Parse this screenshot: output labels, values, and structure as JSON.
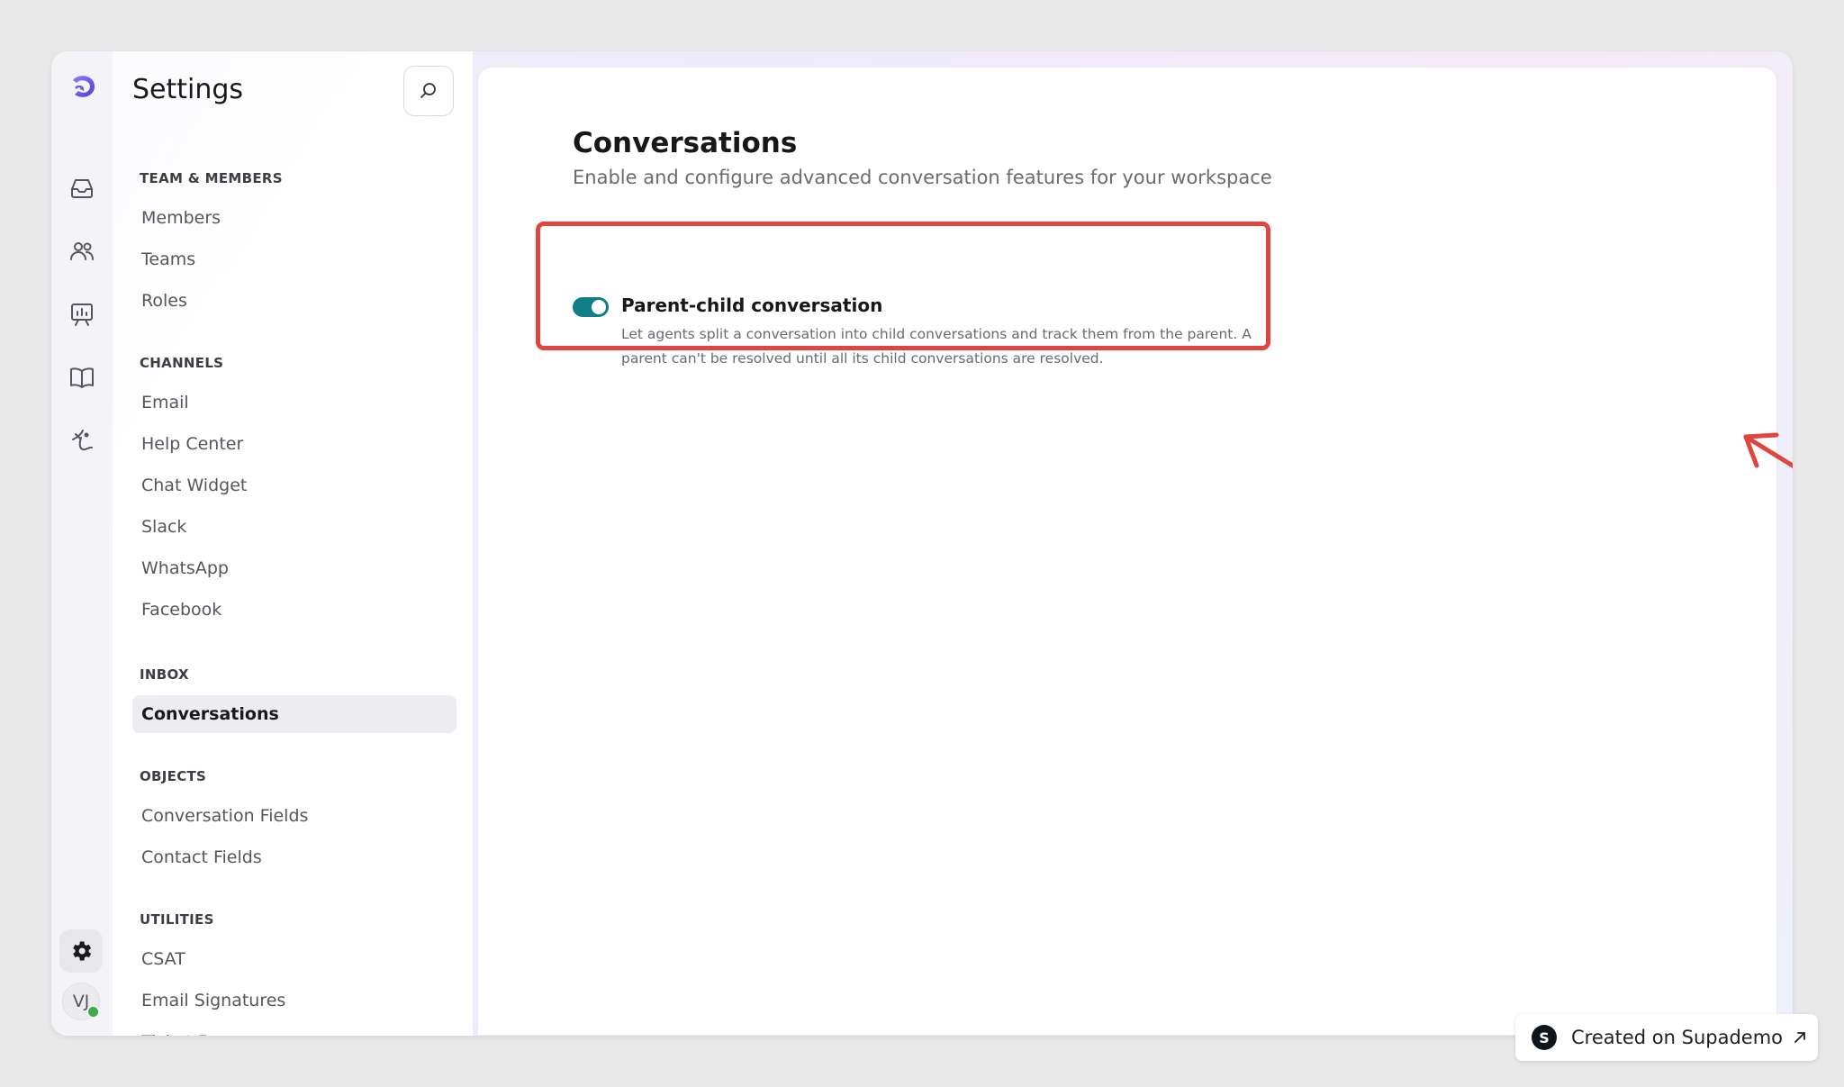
{
  "sidebar": {
    "title": "Settings",
    "groups": [
      {
        "title": "TEAM & MEMBERS",
        "items": [
          {
            "label": "Members"
          },
          {
            "label": "Teams"
          },
          {
            "label": "Roles"
          }
        ]
      },
      {
        "title": "CHANNELS",
        "items": [
          {
            "label": "Email"
          },
          {
            "label": "Help Center"
          },
          {
            "label": "Chat Widget"
          },
          {
            "label": "Slack"
          },
          {
            "label": "WhatsApp"
          },
          {
            "label": "Facebook"
          }
        ]
      },
      {
        "title": "INBOX",
        "items": [
          {
            "label": "Conversations",
            "active": true
          }
        ]
      },
      {
        "title": "OBJECTS",
        "items": [
          {
            "label": "Conversation Fields"
          },
          {
            "label": "Contact Fields"
          }
        ]
      },
      {
        "title": "UTILITIES",
        "items": [
          {
            "label": "CSAT"
          },
          {
            "label": "Email Signatures"
          },
          {
            "label": "Ticket Forms"
          }
        ]
      }
    ]
  },
  "rail": {
    "icons": [
      "inbox-icon",
      "users-icon",
      "analytics-icon",
      "knowledge-book-icon",
      "ai-agent-icon"
    ],
    "avatar_initials": "VJ",
    "settings_icon": "gear-icon"
  },
  "main": {
    "title": "Conversations",
    "subtitle": "Enable and configure advanced conversation features for your workspace",
    "feature": {
      "title": "Parent-child conversation",
      "description": "Let agents split a conversation into child conversations and track them from the parent. A parent can't be resolved until all its child conversations are resolved.",
      "enabled": true
    }
  },
  "badge": {
    "logo_letter": "S",
    "text": "Created on Supademo"
  },
  "colors": {
    "accent_toggle": "#0f7e86",
    "highlight_box": "#e0453f",
    "online_status": "#3fae4a"
  }
}
